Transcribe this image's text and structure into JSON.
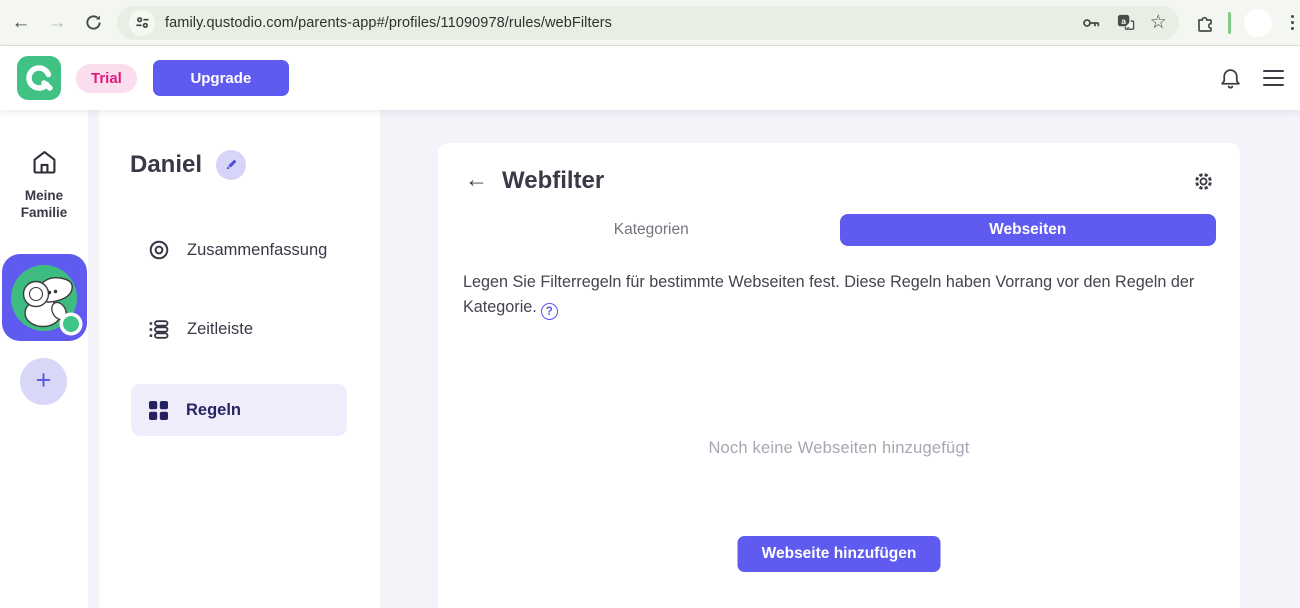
{
  "browser": {
    "url": "family.qustodio.com/parents-app#/profiles/11090978/rules/webFilters"
  },
  "header": {
    "trial_badge": "Trial",
    "upgrade_label": "Upgrade"
  },
  "rail": {
    "home_label": "Meine Familie",
    "plus_label": "+"
  },
  "profile_sidebar": {
    "name": "Daniel",
    "items": [
      {
        "label": "Zusammenfassung",
        "active": false
      },
      {
        "label": "Zeitleiste",
        "active": false
      },
      {
        "label": "Regeln",
        "active": true
      }
    ]
  },
  "main": {
    "back_glyph": "←",
    "title": "Webfilter",
    "tabs": [
      {
        "label": "Kategorien",
        "active": false
      },
      {
        "label": "Webseiten",
        "active": true
      }
    ],
    "description": "Legen Sie Filterregeln für bestimmte Webseiten fest. Diese Regeln haben Vorrang vor den Regeln der Kategorie.",
    "help_glyph": "?",
    "empty_state": "Noch keine Webseiten hinzugefügt",
    "add_button": "Webseite hinzufügen"
  },
  "glyphs": {
    "back": "←",
    "forward": "→",
    "star": "☆"
  },
  "colors": {
    "accent": "#5f5af0",
    "brand_green": "#41c285",
    "trial_bg": "#fbdeed",
    "trial_text": "#e0197d",
    "active_nav_text": "#272465",
    "inactive_tab_text": "#75737e",
    "empty_text": "#a8a6b2"
  }
}
